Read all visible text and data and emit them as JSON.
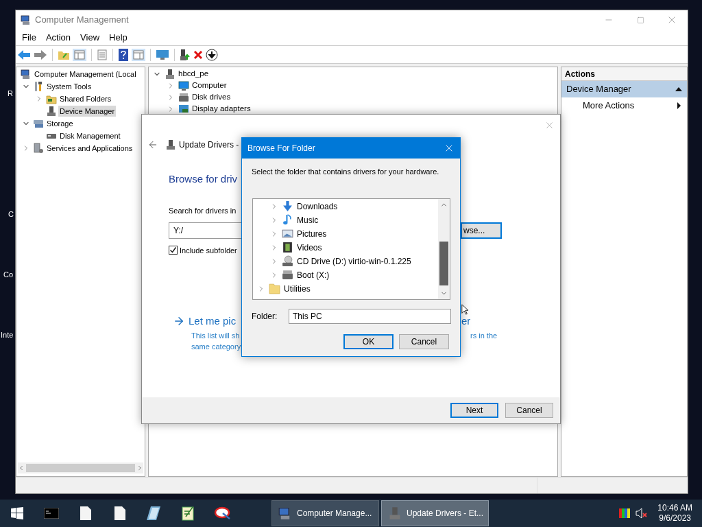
{
  "desktop_icons": [
    {
      "label": "R"
    },
    {
      "label": "C"
    },
    {
      "label": "Co"
    },
    {
      "label": "Inte"
    }
  ],
  "main_window": {
    "title": "Computer Management",
    "menu": [
      "File",
      "Action",
      "View",
      "Help"
    ],
    "nav_tree": [
      {
        "label": "Computer Management (Local",
        "kind": "console",
        "selected": false,
        "children": [
          {
            "label": "System Tools",
            "kind": "tools",
            "expanded": true,
            "selected": false,
            "children": [
              {
                "label": "Shared Folders",
                "kind": "share",
                "expanded": false,
                "selected": false
              },
              {
                "label": "Device Manager",
                "kind": "device",
                "selected": true
              }
            ]
          },
          {
            "label": "Storage",
            "kind": "storage",
            "expanded": true,
            "selected": false,
            "children": [
              {
                "label": "Disk Management",
                "kind": "disk",
                "selected": false
              }
            ]
          },
          {
            "label": "Services and Applications",
            "kind": "services",
            "expanded": false,
            "selected": false
          }
        ]
      }
    ],
    "device_tree": [
      {
        "label": "hbcd_pe",
        "kind": "server",
        "expanded": true,
        "children": [
          {
            "label": "Computer",
            "kind": "monitor",
            "expanded": false
          },
          {
            "label": "Disk drives",
            "kind": "drive",
            "expanded": false
          },
          {
            "label": "Display adapters",
            "kind": "display",
            "expanded": false
          }
        ]
      }
    ],
    "actions": {
      "header": "Actions",
      "section": {
        "label": "Device Manager",
        "expanded": true
      },
      "items": [
        {
          "label": "More Actions"
        }
      ]
    }
  },
  "update_dialog": {
    "title": "Update Drivers -",
    "heading": "Browse for driv",
    "search_label": "Search for drivers in",
    "path": "Y:/",
    "browse_button": "wse...",
    "include_subfolders": {
      "label": "Include subfolder",
      "checked": true
    },
    "link": "Let me pic",
    "link_end": "er",
    "description": "This list will sh",
    "description_end": "rs in the",
    "description_line2": "same category",
    "buttons": [
      {
        "label": "Next",
        "default": true
      },
      {
        "label": "Cancel",
        "default": false
      }
    ]
  },
  "browse_dialog": {
    "title": "Browse For Folder",
    "prompt": "Select the folder that contains drivers for your hardware.",
    "tree": [
      {
        "children": [
          {
            "label": "Downloads",
            "kind": "download",
            "expanded": false
          },
          {
            "label": "Music",
            "kind": "music",
            "expanded": false
          },
          {
            "label": "Pictures",
            "kind": "picture",
            "expanded": false
          },
          {
            "label": "Videos",
            "kind": "video",
            "expanded": false
          },
          {
            "label": "CD Drive (D:) virtio-win-0.1.225",
            "kind": "cd",
            "expanded": false
          },
          {
            "label": "Boot (X:)",
            "kind": "drive",
            "expanded": false
          }
        ]
      },
      {
        "label": "Utilities",
        "kind": "folder",
        "expanded": false
      }
    ],
    "folder_label": "Folder:",
    "folder_value": "This PC",
    "buttons": [
      {
        "label": "OK",
        "default": true
      },
      {
        "label": "Cancel",
        "default": false
      }
    ]
  },
  "taskbar": {
    "windows": [
      {
        "label": "Computer Manage...",
        "kind": "console",
        "selected": false
      },
      {
        "label": "Update Drivers - Et...",
        "kind": "device",
        "selected": true
      }
    ],
    "time": "10:46 AM",
    "date": "9/6/2023"
  }
}
